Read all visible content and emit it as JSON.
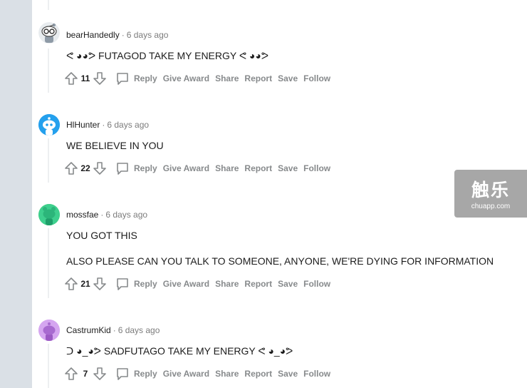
{
  "actions": {
    "reply": "Reply",
    "give_award": "Give Award",
    "share": "Share",
    "report": "Report",
    "save": "Save",
    "follow": "Follow"
  },
  "meta_separator": "·",
  "comments": [
    {
      "author": "bearHandedly",
      "time": "6 days ago",
      "body": [
        "ᕙ ◕◕ᕗ FUTAGOD TAKE MY ENERGY ᕙ ◕◕ᕗ"
      ],
      "score": "11",
      "avatar_color": "#8e9aa6",
      "avatar_icon": "snoo-avatar-glasses-icon"
    },
    {
      "author": "HlHunter",
      "time": "6 days ago",
      "body": [
        "WE BELIEVE IN YOU"
      ],
      "score": "22",
      "avatar_color": "#24a0ed",
      "avatar_icon": "snoo-avatar-blue-icon"
    },
    {
      "author": "mossfae",
      "time": "6 days ago",
      "body": [
        "YOU GOT THIS",
        "ALSO PLEASE CAN YOU TALK TO SOMEONE, ANYONE, WE'RE DYING FOR INFORMATION"
      ],
      "score": "21",
      "avatar_color": "#46d160",
      "avatar_icon": "snoo-avatar-green-icon"
    },
    {
      "author": "CastrumKid",
      "time": "6 days ago",
      "body": [
        "ᑐ ◕_◕ᕗ SADFUTAGO TAKE MY ENERGY ᕙ ◕_◕ᕗ"
      ],
      "score": "7",
      "avatar_color": "#c18ee0",
      "avatar_icon": "snoo-avatar-purple-icon"
    }
  ],
  "watermark": {
    "title": "触乐",
    "subtitle": "chuapp.com"
  }
}
